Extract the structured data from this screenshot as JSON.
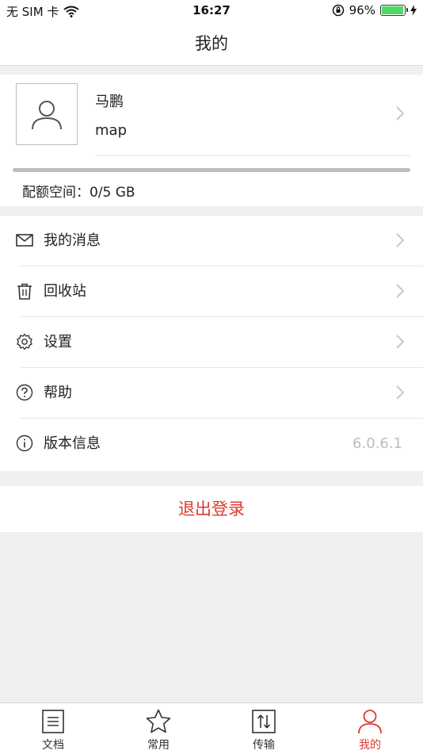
{
  "status_bar": {
    "carrier": "无 SIM 卡",
    "time": "16:27",
    "battery": "96%",
    "battery_level": 0.96,
    "battery_color": "#4cd964"
  },
  "nav": {
    "title": "我的"
  },
  "profile": {
    "name": "马鹏",
    "username": "map",
    "quota_text": "配额空间：0/5 GB",
    "quota_used_fraction": 0.0
  },
  "menu": [
    {
      "label": "我的消息",
      "icon": "envelope-icon",
      "chevron": true
    },
    {
      "label": "回收站",
      "icon": "trash-icon",
      "chevron": true
    },
    {
      "label": "设置",
      "icon": "gear-icon",
      "chevron": true
    },
    {
      "label": "帮助",
      "icon": "help-icon",
      "chevron": true
    },
    {
      "label": "版本信息",
      "icon": "info-icon",
      "value": "6.0.6.1"
    }
  ],
  "logout": {
    "label": "退出登录",
    "color": "#e0392f"
  },
  "tabs": [
    {
      "label": "文档",
      "icon": "document-icon"
    },
    {
      "label": "常用",
      "icon": "star-icon"
    },
    {
      "label": "传输",
      "icon": "transfer-icon"
    },
    {
      "label": "我的",
      "icon": "person-icon",
      "active": true
    }
  ],
  "colors": {
    "accent": "#e0392f",
    "chevron": "#c7c7cc"
  }
}
